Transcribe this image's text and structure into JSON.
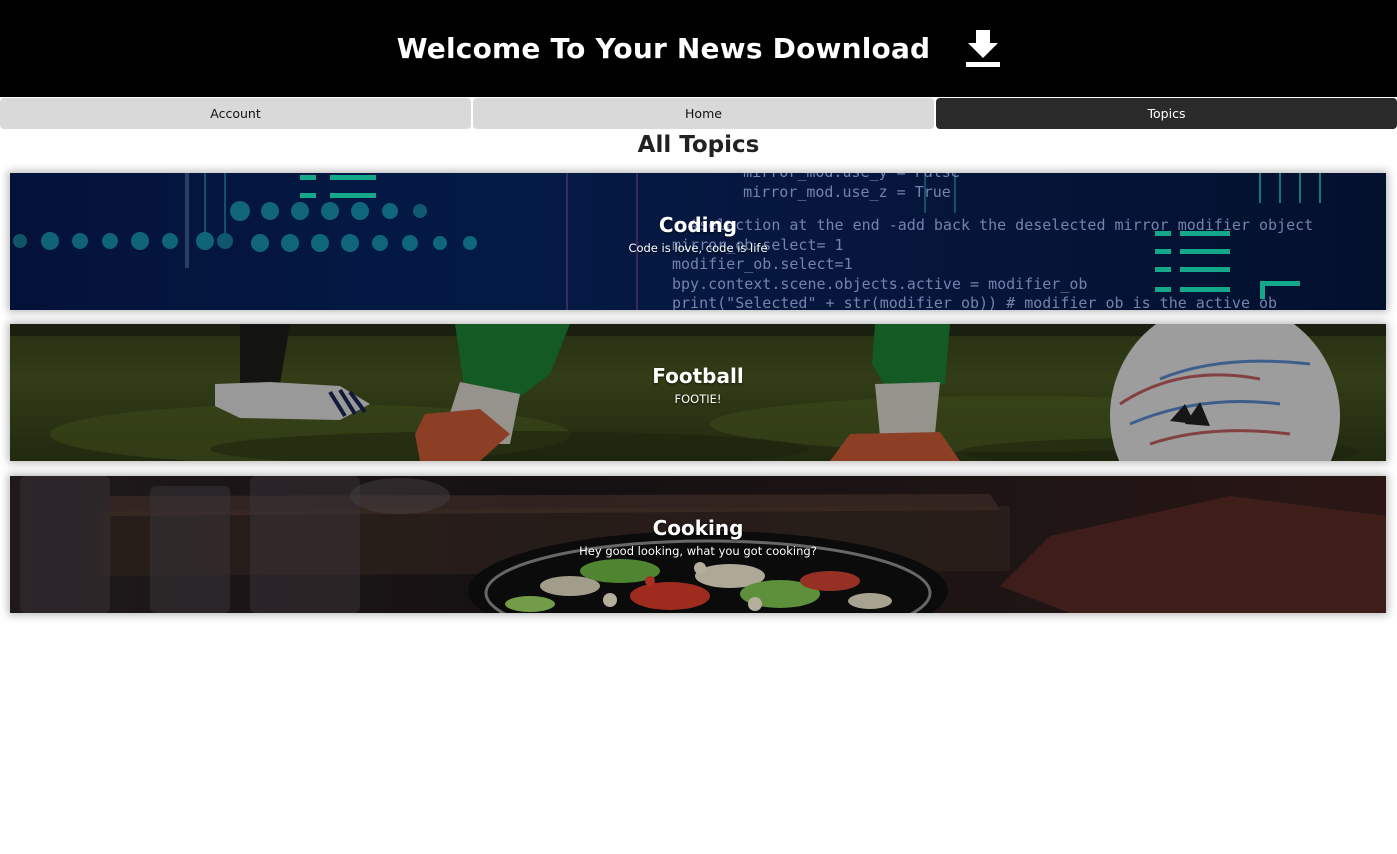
{
  "header": {
    "title": "Welcome To Your News Download",
    "download_icon": "download-icon",
    "background": "#000000"
  },
  "nav": {
    "tabs": [
      {
        "label": "Account",
        "active": false
      },
      {
        "label": "Home",
        "active": false
      },
      {
        "label": "Topics",
        "active": true
      }
    ]
  },
  "main": {
    "title": "All Topics",
    "topics": [
      {
        "title": "Coding",
        "subtitle": "Code is love, code is life",
        "image": "code-screen-image"
      },
      {
        "title": "Football",
        "subtitle": "FOOTIE!",
        "image": "football-kick-image"
      },
      {
        "title": "Cooking",
        "subtitle": "Hey good looking, what you got cooking?",
        "image": "stir-fry-pan-image"
      }
    ]
  },
  "colors": {
    "tab_inactive": "#d9d9d9",
    "tab_active": "#2a2a2a",
    "text_light": "#ffffff"
  }
}
